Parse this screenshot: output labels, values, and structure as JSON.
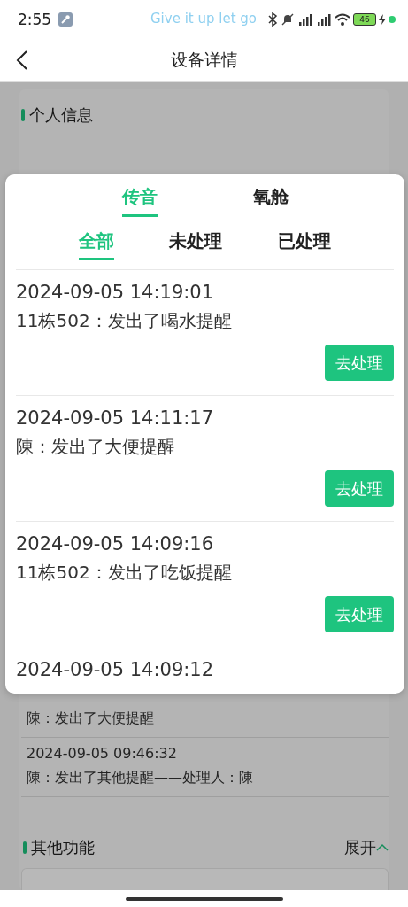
{
  "status_bar": {
    "time": "2:55",
    "ticker": "Give it up let go",
    "battery": "46"
  },
  "header": {
    "title": "设备详情"
  },
  "page": {
    "personal_info": {
      "title": "个人信息"
    },
    "records": [
      {
        "text": "陳：发出了大便提醒"
      },
      {
        "time": "2024-09-05 09:46:32",
        "text": "陳：发出了其他提醒——处理人：陳"
      }
    ],
    "other_functions": {
      "title": "其他功能",
      "toggle": "展开",
      "expanded": true
    }
  },
  "dialog": {
    "tabs": [
      {
        "label": "传音",
        "selected": true
      },
      {
        "label": "氧舱",
        "selected": false
      }
    ],
    "filters": [
      {
        "label": "全部",
        "selected": true
      },
      {
        "label": "未处理",
        "selected": false
      },
      {
        "label": "已处理",
        "selected": false
      }
    ],
    "items": [
      {
        "time": "2024-09-05 14:19:01",
        "text": "11栋502：发出了喝水提醒",
        "action": "去处理"
      },
      {
        "time": "2024-09-05 14:11:17",
        "text": "陳：发出了大便提醒",
        "action": "去处理"
      },
      {
        "time": "2024-09-05 14:09:16",
        "text": "11栋502：发出了吃饭提醒",
        "action": "去处理"
      },
      {
        "time": "2024-09-05 14:09:12"
      }
    ]
  }
}
